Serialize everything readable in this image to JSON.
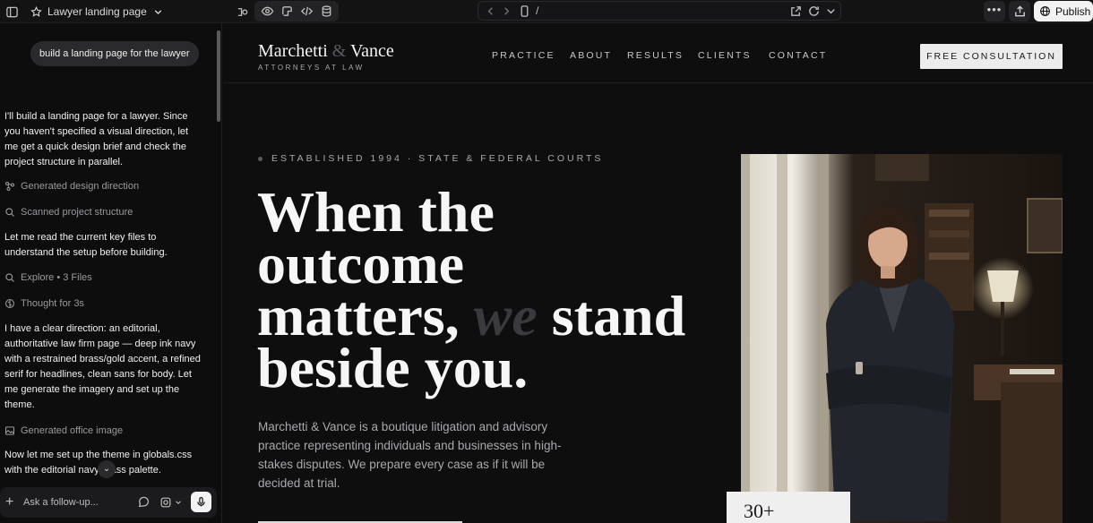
{
  "topbar": {
    "project_name": "Lawyer landing page",
    "url_path": "/",
    "more_label": "•••",
    "publish_label": "Publish"
  },
  "chat": {
    "user_message": "build a landing page for the lawyer",
    "messages": [
      "I'll build a landing page for a lawyer. Since you haven't specified a visual direction, let me get a quick design brief and check the project structure in parallel.",
      "Let me read the current key files to understand the setup before building.",
      "I have a clear direction: an editorial, authoritative law firm page — deep ink navy with a restrained brass/gold accent, a refined serif for headlines, clean sans for body. Let me generate the imagery and set up the theme.",
      "Now let me set up the theme in globals.css with the editorial navy/brass palette."
    ],
    "steps": [
      "Generated design direction",
      "Scanned project structure",
      "Explore • 3 Files",
      "Thought for 3s",
      "Generated office image"
    ],
    "composer_placeholder": "Ask a follow-up..."
  },
  "site": {
    "logo": {
      "first": "Marchetti",
      "amp": "&",
      "last": "Vance",
      "subtitle": "ATTORNEYS AT LAW"
    },
    "nav": [
      "PRACTICE",
      "ABOUT",
      "RESULTS",
      "CLIENTS",
      "CONTACT"
    ],
    "cta": "FREE CONSULTATION",
    "eyebrow": "ESTABLISHED 1994 · STATE & FEDERAL COURTS",
    "headline": {
      "line1": "When the",
      "line2": "outcome",
      "line3_a": "matters, ",
      "line3_accent": "we",
      "line3_b": " stand",
      "line4": "beside you."
    },
    "body": "Marchetti & Vance is a boutique litigation and advisory practice representing individuals and businesses in high-stakes disputes. We prepare every case as if it will be decided at trial.",
    "stat_number": "30+"
  },
  "colors": {
    "background": "#0e0e0f",
    "accent_text": "#3a3a3e",
    "publish_bg": "#f2f2f2"
  }
}
